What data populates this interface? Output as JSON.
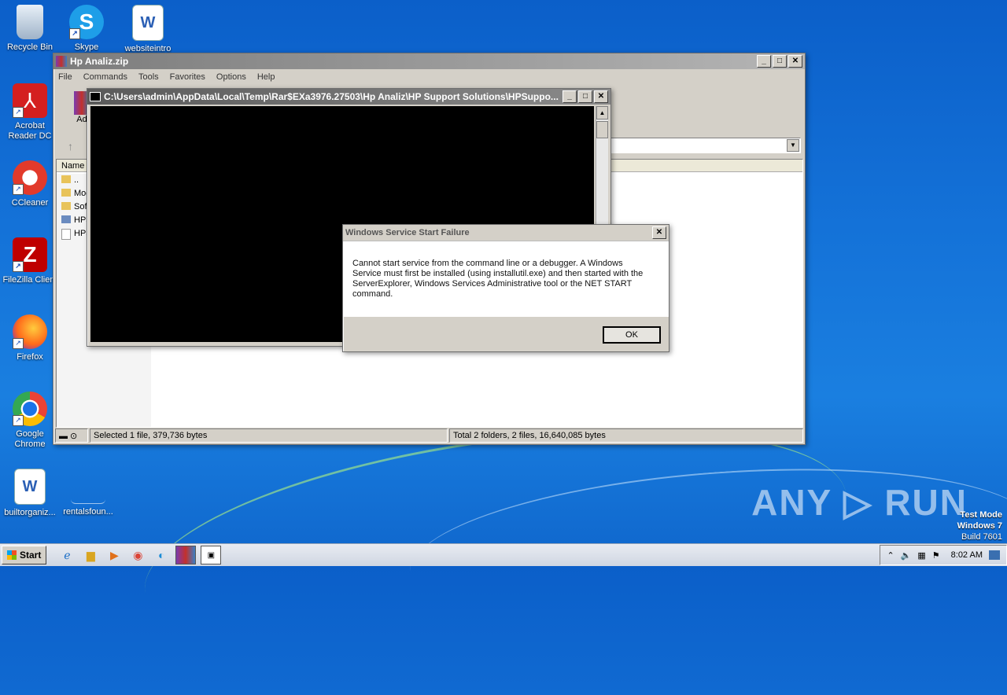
{
  "desktop": {
    "icons": [
      {
        "label": "Recycle Bin",
        "icon": "recycle-bin-icon"
      },
      {
        "label": "Skype",
        "icon": "skype-icon"
      },
      {
        "label": "websiteintro",
        "icon": "word-doc-icon"
      },
      {
        "label": "Acrobat Reader DC",
        "icon": "acrobat-icon"
      },
      {
        "label": "CCleaner",
        "icon": "ccleaner-icon"
      },
      {
        "label": "FileZilla Client",
        "icon": "filezilla-icon"
      },
      {
        "label": "Firefox",
        "icon": "firefox-icon"
      },
      {
        "label": "Google Chrome",
        "icon": "chrome-icon"
      },
      {
        "label": "builtorganiz...",
        "icon": "word-doc-icon"
      },
      {
        "label": "rentalsfoun...",
        "icon": "blank-file-icon"
      }
    ],
    "watermark": "ANY ▷ RUN",
    "test_mode": {
      "line1": "Test Mode",
      "line2": "Windows 7",
      "line3": "Build 7601"
    }
  },
  "winrar": {
    "title": "Hp Analiz.zip",
    "menu": [
      "File",
      "Commands",
      "Tools",
      "Favorites",
      "Options",
      "Help"
    ],
    "toolbar_label": "Ad",
    "column_name": "Name",
    "files": [
      "..",
      "Moc",
      "Sof",
      "HPS",
      "HPS"
    ],
    "status_left": "Selected 1 file, 379,736 bytes",
    "status_right": "Total 2 folders, 2 files, 16,640,085 bytes"
  },
  "console": {
    "title": "C:\\Users\\admin\\AppData\\Local\\Temp\\Rar$EXa3976.27503\\Hp Analiz\\HP Support Solutions\\HPSuppo..."
  },
  "dialog": {
    "title": "Windows Service Start Failure",
    "message": "Cannot start service from the command line or a debugger.  A Windows Service must first be installed (using installutil.exe) and then started with the ServerExplorer, Windows Services Administrative tool or the NET START command.",
    "ok_label": "OK"
  },
  "taskbar": {
    "start_label": "Start",
    "clock": "8:02 AM"
  }
}
